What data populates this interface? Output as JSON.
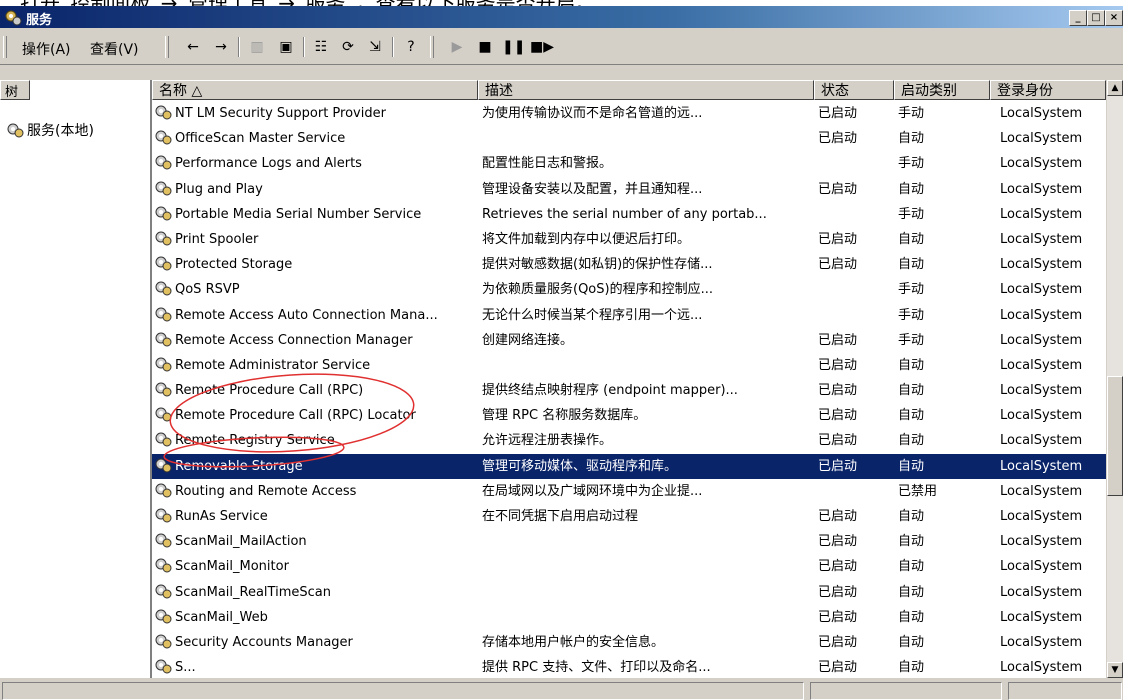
{
  "top_caption": "打开“控制面板”→“管理工具”→“服务”，查看以下服务是否开启。",
  "window": {
    "title": "服务"
  },
  "menu": {
    "action": "操作(A)",
    "view": "查看(V)"
  },
  "tree": {
    "header": "树",
    "root": "服务(本地)"
  },
  "columns": {
    "name": "名称 △",
    "desc": "描述",
    "status": "状态",
    "startup": "启动类别",
    "logon": "登录身份"
  },
  "rows": [
    {
      "name": "NT LM Security Support Provider",
      "desc": "为使用传输协议而不是命名管道的远...",
      "status": "已启动",
      "startup": "手动",
      "logon": "LocalSystem"
    },
    {
      "name": "OfficeScan Master Service",
      "desc": "",
      "status": "已启动",
      "startup": "自动",
      "logon": "LocalSystem"
    },
    {
      "name": "Performance Logs and Alerts",
      "desc": "配置性能日志和警报。",
      "status": "",
      "startup": "手动",
      "logon": "LocalSystem"
    },
    {
      "name": "Plug and Play",
      "desc": "管理设备安装以及配置，并且通知程...",
      "status": "已启动",
      "startup": "自动",
      "logon": "LocalSystem"
    },
    {
      "name": "Portable Media Serial Number Service",
      "desc": "Retrieves the serial number of any portab...",
      "status": "",
      "startup": "手动",
      "logon": "LocalSystem"
    },
    {
      "name": "Print Spooler",
      "desc": "将文件加载到内存中以便迟后打印。",
      "status": "已启动",
      "startup": "自动",
      "logon": "LocalSystem"
    },
    {
      "name": "Protected Storage",
      "desc": "提供对敏感数据(如私钥)的保护性存储...",
      "status": "已启动",
      "startup": "自动",
      "logon": "LocalSystem"
    },
    {
      "name": "QoS RSVP",
      "desc": "为依赖质量服务(QoS)的程序和控制应...",
      "status": "",
      "startup": "手动",
      "logon": "LocalSystem"
    },
    {
      "name": "Remote Access Auto Connection Mana...",
      "desc": "无论什么时候当某个程序引用一个远...",
      "status": "",
      "startup": "手动",
      "logon": "LocalSystem"
    },
    {
      "name": "Remote Access Connection Manager",
      "desc": "创建网络连接。",
      "status": "已启动",
      "startup": "手动",
      "logon": "LocalSystem"
    },
    {
      "name": "Remote Administrator Service",
      "desc": "",
      "status": "已启动",
      "startup": "自动",
      "logon": "LocalSystem"
    },
    {
      "name": "Remote Procedure Call (RPC)",
      "desc": "提供终结点映射程序 (endpoint mapper)...",
      "status": "已启动",
      "startup": "自动",
      "logon": "LocalSystem"
    },
    {
      "name": "Remote Procedure Call (RPC) Locator",
      "desc": "管理 RPC 名称服务数据库。",
      "status": "已启动",
      "startup": "自动",
      "logon": "LocalSystem"
    },
    {
      "name": "Remote Registry Service",
      "desc": "允许远程注册表操作。",
      "status": "已启动",
      "startup": "自动",
      "logon": "LocalSystem"
    },
    {
      "name": "Removable Storage",
      "desc": "管理可移动媒体、驱动程序和库。",
      "status": "已启动",
      "startup": "自动",
      "logon": "LocalSystem",
      "selected": true
    },
    {
      "name": "Routing and Remote Access",
      "desc": "在局域网以及广域网环境中为企业提...",
      "status": "",
      "startup": "已禁用",
      "logon": "LocalSystem"
    },
    {
      "name": "RunAs Service",
      "desc": "在不同凭据下启用启动过程",
      "status": "已启动",
      "startup": "自动",
      "logon": "LocalSystem"
    },
    {
      "name": "ScanMail_MailAction",
      "desc": "",
      "status": "已启动",
      "startup": "自动",
      "logon": "LocalSystem"
    },
    {
      "name": "ScanMail_Monitor",
      "desc": "",
      "status": "已启动",
      "startup": "自动",
      "logon": "LocalSystem"
    },
    {
      "name": "ScanMail_RealTimeScan",
      "desc": "",
      "status": "已启动",
      "startup": "自动",
      "logon": "LocalSystem"
    },
    {
      "name": "ScanMail_Web",
      "desc": "",
      "status": "已启动",
      "startup": "自动",
      "logon": "LocalSystem"
    },
    {
      "name": "Security Accounts Manager",
      "desc": "存储本地用户帐户的安全信息。",
      "status": "已启动",
      "startup": "自动",
      "logon": "LocalSystem"
    },
    {
      "name": "S...",
      "desc": "提供 RPC 支持、文件、打印以及命名...",
      "status": "已启动",
      "startup": "自动",
      "logon": "LocalSystem"
    }
  ],
  "colors": {
    "selection": "#0a246a",
    "annotation": "#e03030"
  }
}
